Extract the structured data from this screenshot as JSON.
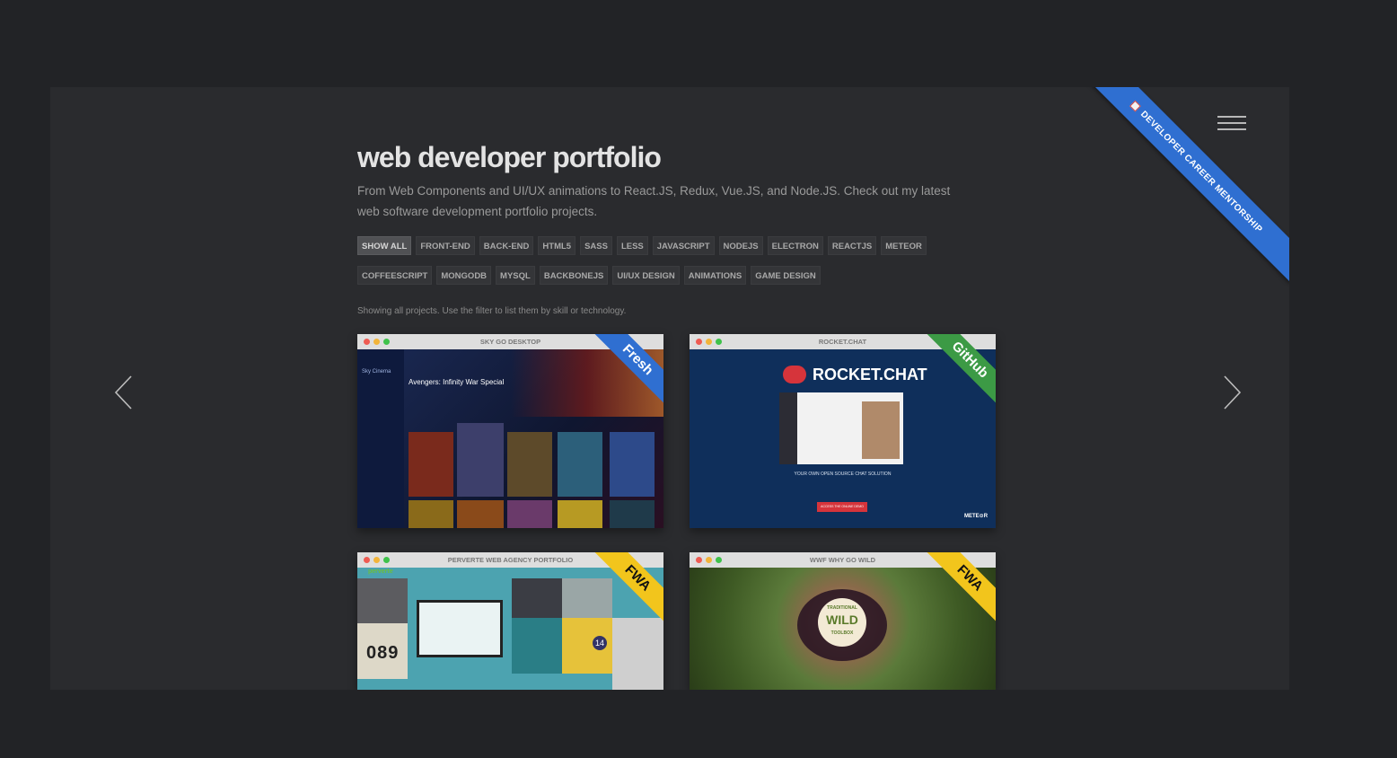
{
  "ribbon": {
    "label": "DEVELOPER CAREER MENTORSHIP",
    "color": "#2f6fd1"
  },
  "header": {
    "title": "web developer portfolio",
    "description": "From Web Components and UI/UX animations to React.JS, Redux, Vue.JS, and Node.JS. Check out my latest web software development portfolio projects."
  },
  "filters": [
    "SHOW ALL",
    "FRONT-END",
    "BACK-END",
    "HTML5",
    "SASS",
    "LESS",
    "JAVASCRIPT",
    "NODEJS",
    "ELECTRON",
    "REACTJS",
    "METEOR",
    "COFFEESCRIPT",
    "MONGODB",
    "MYSQL",
    "BACKBONEJS",
    "UI/UX DESIGN",
    "ANIMATIONS",
    "GAME DESIGN"
  ],
  "active_filter": "SHOW ALL",
  "showing_text": "Showing all projects. Use the filter to list them by skill or technology.",
  "projects": [
    {
      "title": "SKY GO DESKTOP",
      "badge": "Fresh",
      "badge_color": "#2f6fd1",
      "screen_heading": "Avengers: Infinity War Special",
      "screen_sub": "Sky Cinema"
    },
    {
      "title": "ROCKET.CHAT",
      "badge": "GitHub",
      "badge_color": "#3c9a45",
      "screen_heading": "ROCKET.CHAT",
      "screen_sub": "YOUR OWN OPEN SOURCE CHAT SOLUTION",
      "screen_button": "ACCESS THE ONLINE DEMO",
      "screen_footer": "METE⊙R"
    },
    {
      "title": "PERVERTE WEB AGENCY PORTFOLIO",
      "badge": "FWA",
      "badge_color": "#f2c51c",
      "screen_heading": "perverte",
      "screen_counter": "089",
      "screen_num": "14"
    },
    {
      "title": "WWF WHY GO WILD",
      "badge": "FWA",
      "badge_color": "#f2c51c",
      "screen_heading": "TRADITIONAL",
      "screen_sub": "WILD",
      "screen_sub2": "TOOLBOX"
    }
  ],
  "window_dot_colors": [
    "#ee5b52",
    "#f2b43a",
    "#3fc24b"
  ]
}
